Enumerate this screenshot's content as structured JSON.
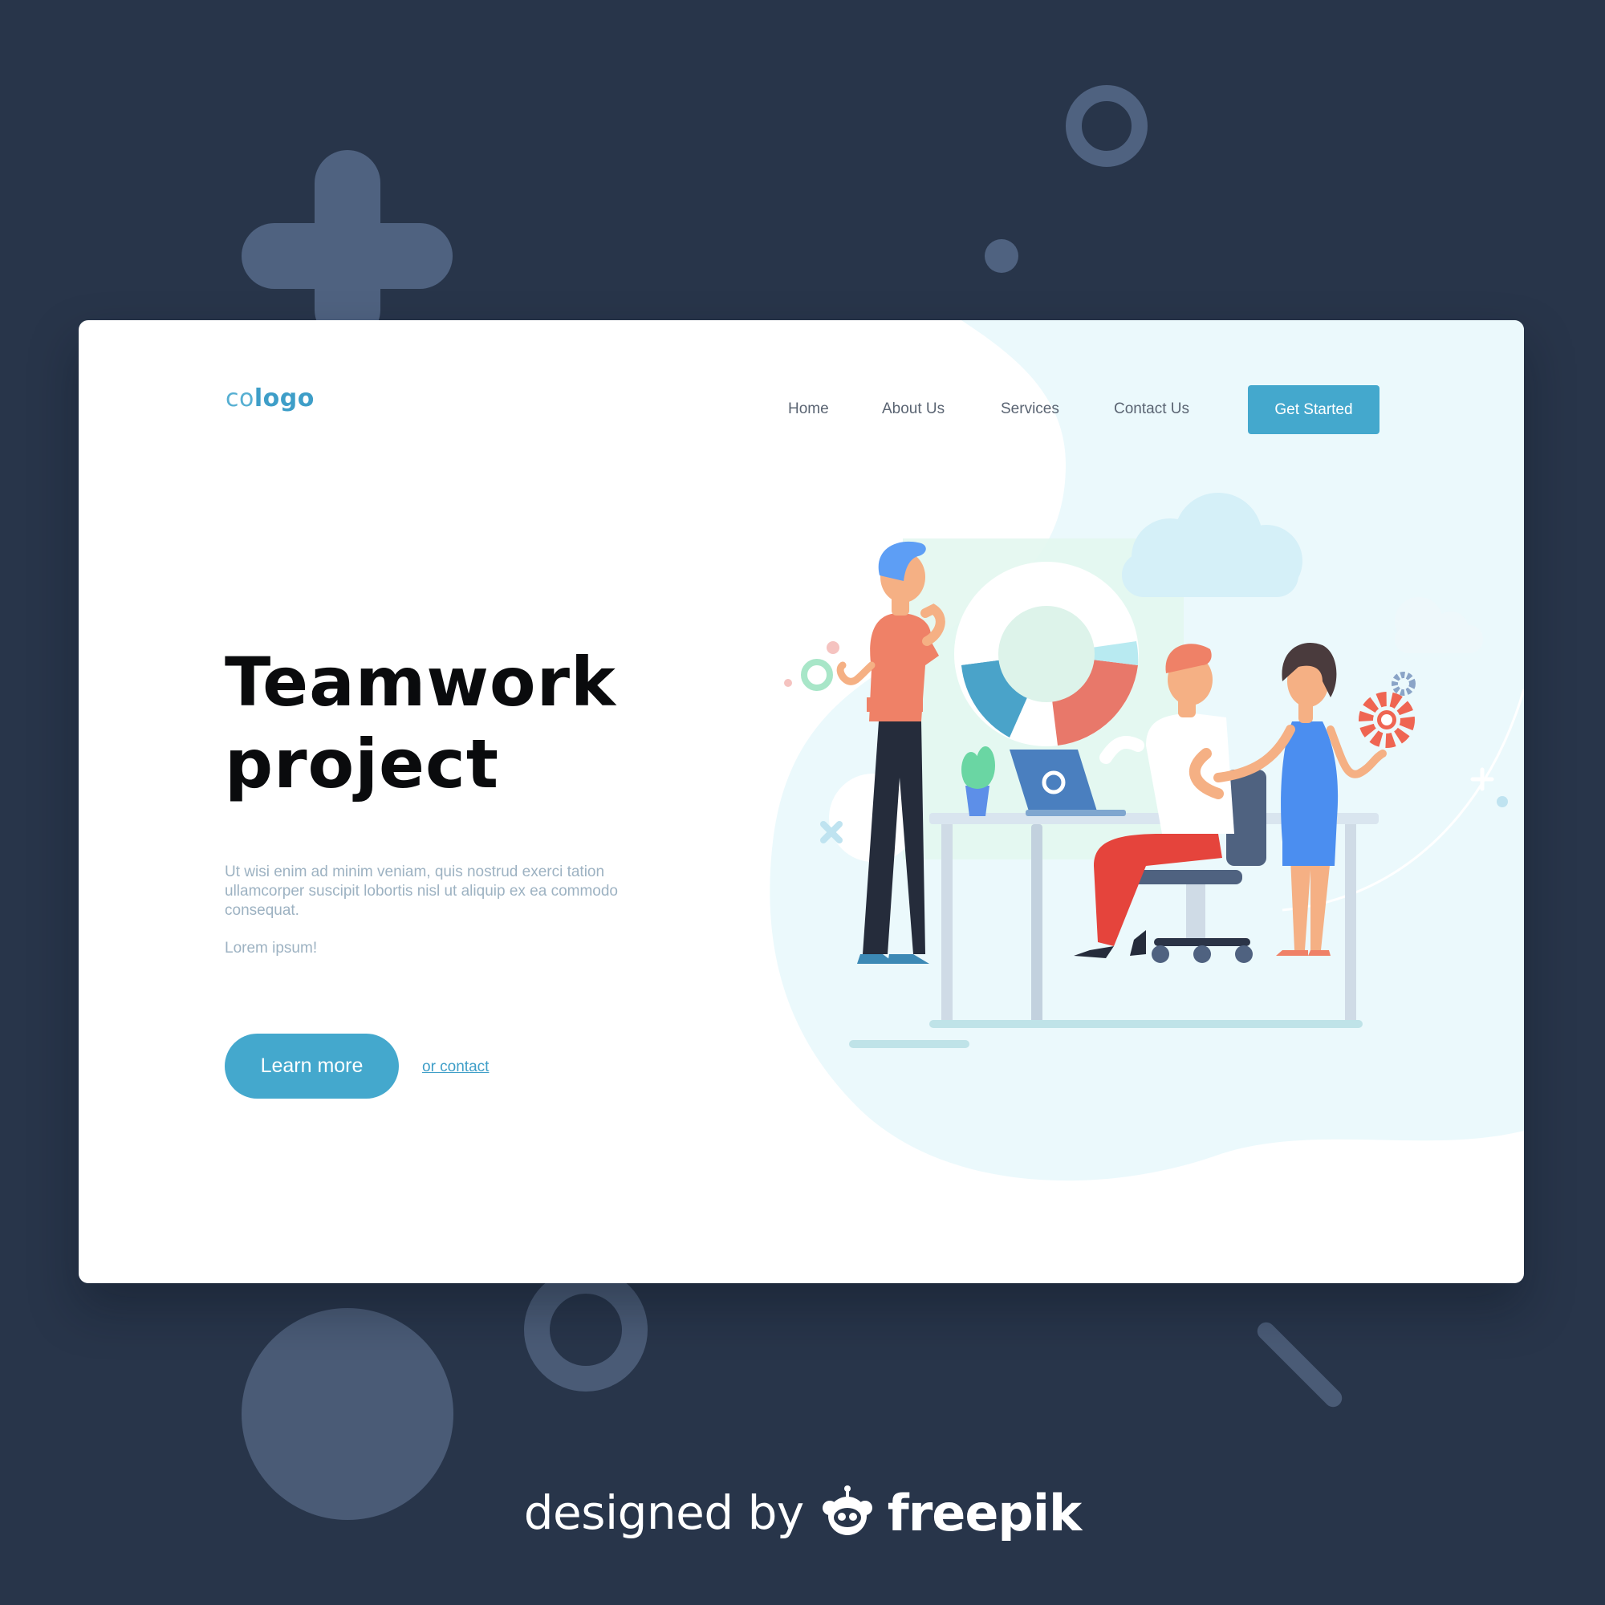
{
  "header": {
    "logo_prefix": "co",
    "logo_main": "logo",
    "nav": [
      "Home",
      "About Us",
      "Services",
      "Contact Us"
    ],
    "cta_label": "Get Started"
  },
  "hero": {
    "title_line1": "Teamwork",
    "title_line2": "project",
    "description": "Ut wisi enim ad minim veniam, quis nostrud exerci tation ullamcorper suscipit lobortis nisl ut aliquip ex ea commodo consequat.",
    "note": "Lorem ipsum!",
    "primary_button": "Learn more",
    "secondary_link": "or contact"
  },
  "footer": {
    "designed_by": "designed by",
    "brand": "freepik"
  },
  "colors": {
    "page_background": "#28354a",
    "card_background": "#ffffff",
    "accent": "#44a8cd",
    "title_text": "#0a0b0d",
    "muted_text": "#9db2c2",
    "nav_text": "#5a6472",
    "decor_shapes": "#4f6280"
  },
  "icons": [
    "plus-shape",
    "ring-shape",
    "dot-shape",
    "team-illustration",
    "freepik-mascot-icon"
  ]
}
